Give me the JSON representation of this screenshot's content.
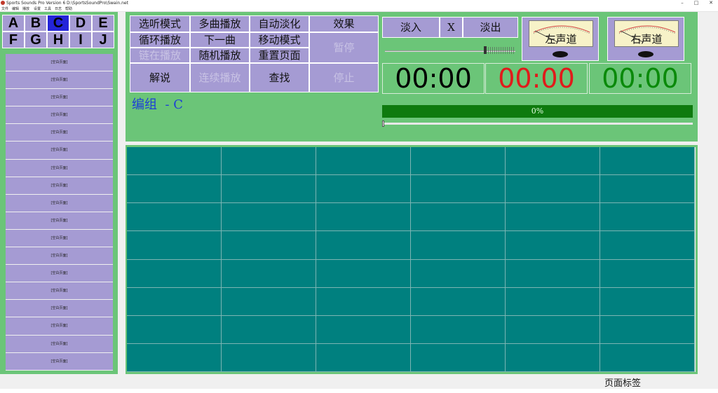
{
  "window": {
    "title": "Sports Sounds Pro Version 6",
    "path": "D:\\SportsSoundPro\\Swain.net",
    "controls": [
      "–",
      "□",
      "✕"
    ]
  },
  "menu": [
    "文件",
    "编辑",
    "播放",
    "设置",
    "工具",
    "日志",
    "帮助"
  ],
  "letters": [
    "A",
    "B",
    "C",
    "D",
    "E",
    "F",
    "G",
    "H",
    "I",
    "J"
  ],
  "active_letter": "C",
  "page_items": [
    "[空白页面]",
    "[空白页面]",
    "[空白页面]",
    "[空白页面]",
    "[空白页面]",
    "[空白页面]",
    "[空白页面]",
    "[空白页面]",
    "[空白页面]",
    "[空白页面]",
    "[空白页面]",
    "[空白页面]",
    "[空白页面]",
    "[空白页面]",
    "[空白页面]",
    "[空白页面]",
    "[空白页面]",
    "[空白页面]"
  ],
  "buttons": {
    "select_mode": "选听模式",
    "multi_play": "多曲播放",
    "auto_fade": "自动淡化",
    "effects": "效果",
    "loop_play": "循环播放",
    "next_track": "下一曲",
    "move_mode": "移动模式",
    "pause": "暂停",
    "chain_play": "链在播放",
    "random_play": "随机播放",
    "reset_page": "重置页面",
    "narrate": "解说",
    "continuous_play": "连续播放",
    "find": "查找",
    "stop": "停止",
    "fade_in": "淡入",
    "x": "X",
    "fade_out": "淡出"
  },
  "group_label": "编组  - C",
  "meters": {
    "left": "左声道",
    "right": "右声道"
  },
  "timers": {
    "elapsed": "00:00",
    "remaining": "00:00",
    "total": "00:00"
  },
  "colors": {
    "elapsed": "#000000",
    "remaining": "#e01b1b",
    "total": "#0a8a0a"
  },
  "progress": {
    "label": "0%",
    "value": 0
  },
  "volume_slider": {
    "value": 0.77
  },
  "grid": {
    "rows": 8,
    "cols": 6
  },
  "footer": {
    "page_tab_label": "页面标签"
  }
}
